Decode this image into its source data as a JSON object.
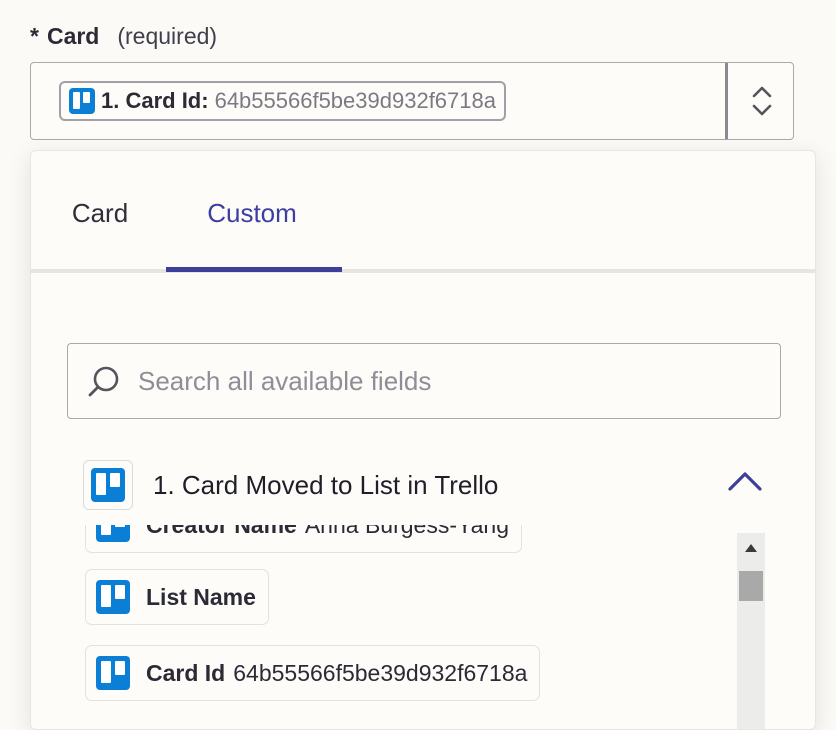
{
  "field": {
    "required_marker": "*",
    "label": "Card",
    "required_note": "(required)",
    "selected_pill": {
      "label": "1. Card Id:",
      "value": "64b55566f5be39d932f6718a"
    }
  },
  "picker": {
    "tabs": [
      {
        "label": "Card",
        "active": false
      },
      {
        "label": "Custom",
        "active": true
      }
    ],
    "search": {
      "placeholder": "Search all available fields",
      "value": ""
    },
    "group": {
      "title": "1. Card Moved to List in Trello",
      "expanded": true
    },
    "items": [
      {
        "label": "Creator Name",
        "value": "Anna Burgess-Yang"
      },
      {
        "label": "List Name",
        "value": ""
      },
      {
        "label": "Card Id",
        "value": "64b55566f5be39d932f6718a"
      }
    ]
  },
  "icons": {
    "app": "trello-icon",
    "search": "search-icon",
    "stepper": "chevron-up-down-icon",
    "collapse": "chevron-up-icon",
    "scroll_up": "triangle-up-icon"
  },
  "colors": {
    "accent": "#3d4099",
    "trello": "#0b7fd6",
    "background": "#fbfaf6"
  }
}
